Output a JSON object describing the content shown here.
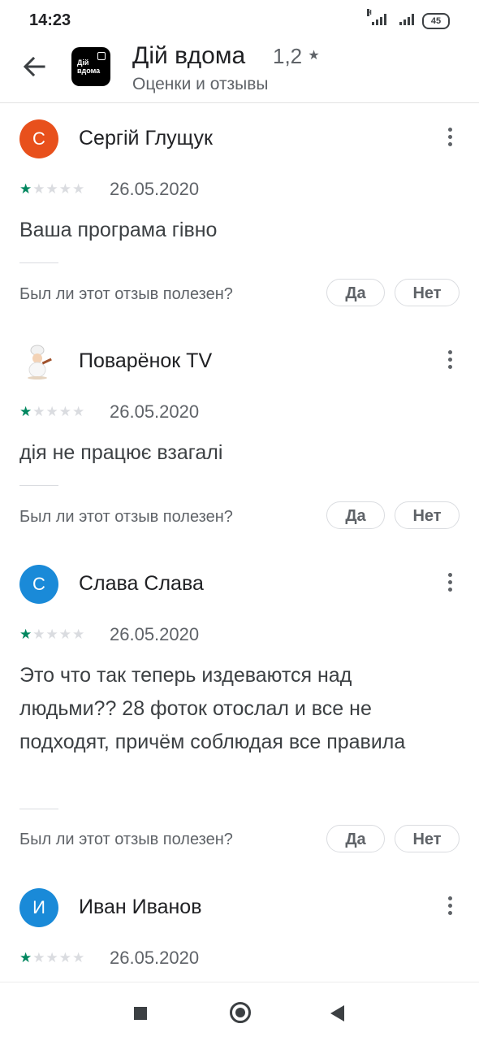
{
  "status": {
    "time": "14:23",
    "signal_label": "H",
    "battery": "45"
  },
  "app": {
    "name": "Дій вдома",
    "rating": "1,2",
    "rating_star": "★",
    "subtitle": "Оценки и отзывы",
    "logo_line1": "Дій",
    "logo_line2": "вдома"
  },
  "helpful": {
    "question": "Был ли этот отзыв полезен?",
    "yes": "Да",
    "no": "Нет"
  },
  "reviews": [
    {
      "initial": "С",
      "avatar_color": "#e8501c",
      "name": "Сергій Глущук",
      "stars": 1,
      "date": "26.05.2020",
      "text": "Ваша програма гівно"
    },
    {
      "initial": "",
      "avatar_color": "photo",
      "name": "Поварёнок TV",
      "stars": 1,
      "date": "26.05.2020",
      "text": "дія не працює взагалі"
    },
    {
      "initial": "С",
      "avatar_color": "#1a8ad8",
      "name": "Слава Слава",
      "stars": 1,
      "date": "26.05.2020",
      "text": "Это что так теперь издеваются над людьми?? 28 фоток отослал и все не подходят, причём соблюдая все правила"
    },
    {
      "initial": "И",
      "avatar_color": "#1a8ad8",
      "name": "Иван Иванов",
      "stars": 1,
      "date": "26.05.2020",
      "text": ""
    }
  ],
  "icons": {
    "back": "back-arrow-icon",
    "more": "more-vert-icon",
    "nav_recents": "square-icon",
    "nav_home": "home-circle-icon",
    "nav_back": "triangle-back-icon"
  },
  "colors": {
    "star_on": "#01875f",
    "star_off": "#dadce0",
    "accent_orange": "#e8501c",
    "accent_blue": "#1a8ad8"
  }
}
